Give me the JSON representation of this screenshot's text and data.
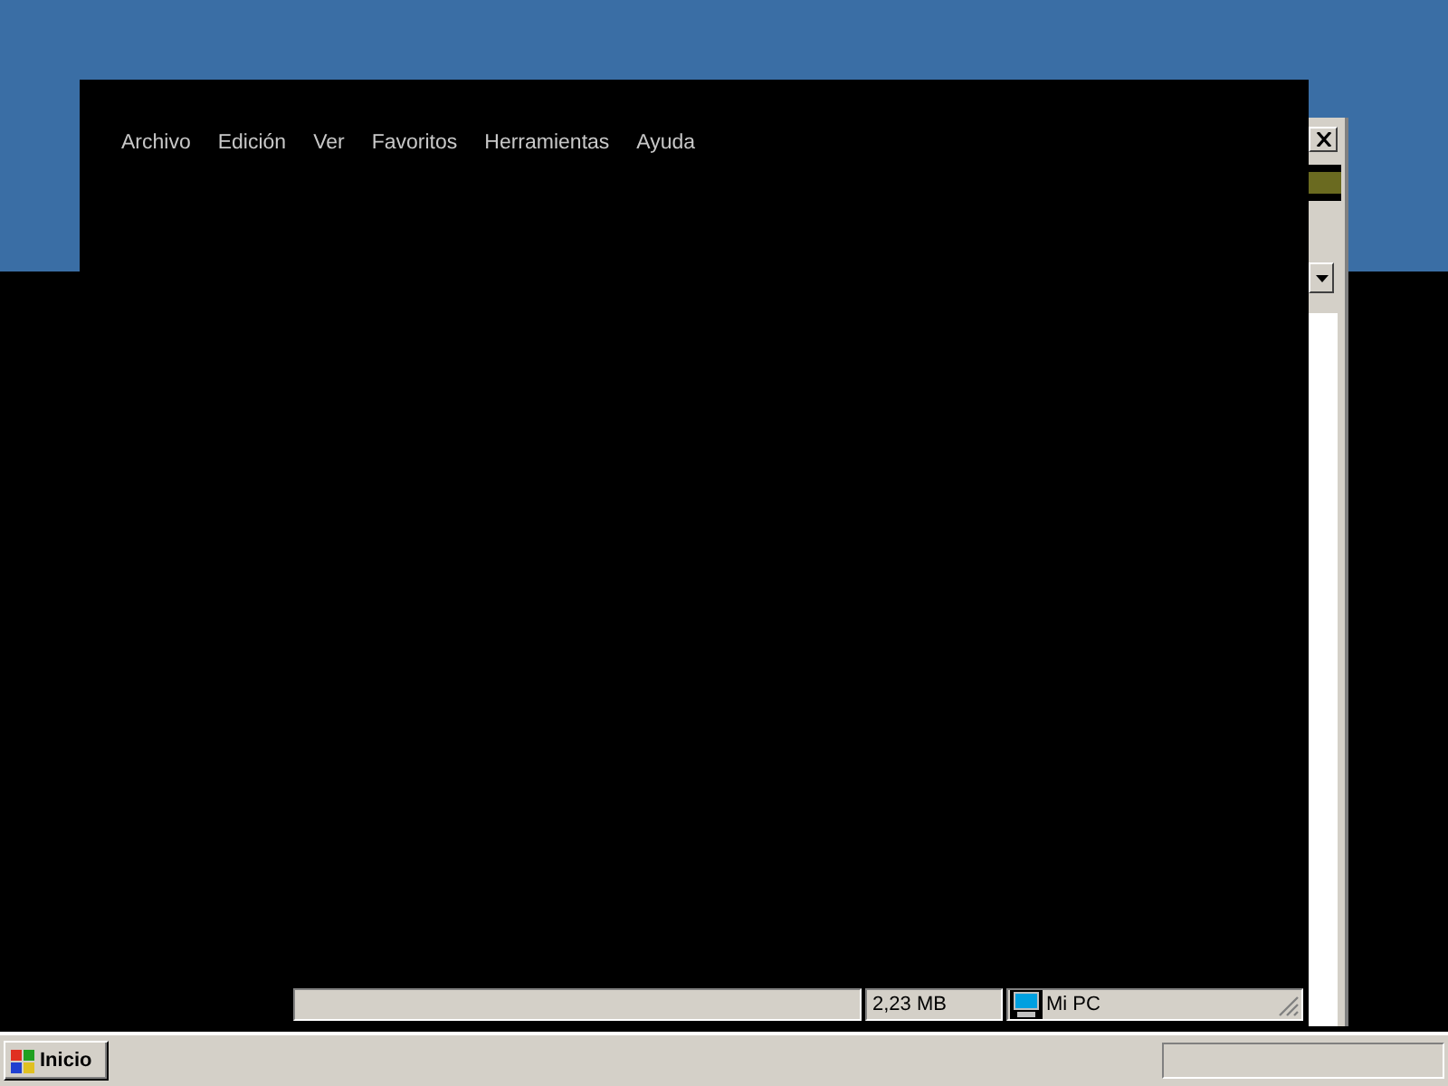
{
  "menu_bar": {
    "items": [
      {
        "label": "Archivo"
      },
      {
        "label": "Edición"
      },
      {
        "label": "Ver"
      },
      {
        "label": "Favoritos"
      },
      {
        "label": "Herramientas"
      },
      {
        "label": "Ayuda"
      }
    ]
  },
  "status_bar": {
    "panels": [
      {
        "kind": "text",
        "text": "2,23 MB"
      },
      {
        "kind": "computer",
        "text": "Mi PC"
      }
    ]
  },
  "taskbar": {
    "start_button": "Inicio"
  }
}
